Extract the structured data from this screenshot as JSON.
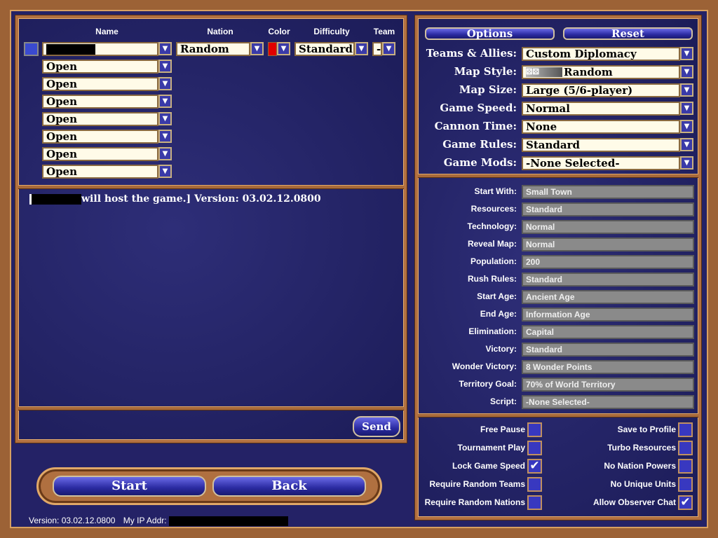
{
  "players": {
    "headers": {
      "name": "Name",
      "nation": "Nation",
      "color": "Color",
      "difficulty": "Difficulty",
      "team": "Team"
    },
    "host": {
      "name": "",
      "nation": "Random",
      "color_hex": "#e00000",
      "difficulty": "Standard",
      "team": "-",
      "slot_color_hex": "#3a4ad0"
    },
    "open_slots": [
      "Open",
      "Open",
      "Open",
      "Open",
      "Open",
      "Open",
      "Open"
    ]
  },
  "chat": {
    "message": "will host the game.] Version: 03.02.12.0800",
    "send_label": "Send"
  },
  "options": {
    "options_label": "Options",
    "reset_label": "Reset",
    "dropdowns": [
      {
        "label": "Teams & Allies:",
        "value": "Custom Diplomacy"
      },
      {
        "label": "Map Style:",
        "value": "Random",
        "icon": "dice-icon"
      },
      {
        "label": "Map Size:",
        "value": "Large (5/6-player)"
      },
      {
        "label": "Game Speed:",
        "value": "Normal"
      },
      {
        "label": "Cannon Time:",
        "value": "None"
      },
      {
        "label": "Game Rules:",
        "value": "Standard"
      },
      {
        "label": "Game Mods:",
        "value": "-None Selected-"
      }
    ],
    "settings": [
      {
        "label": "Start With:",
        "value": "Small Town"
      },
      {
        "label": "Resources:",
        "value": "Standard"
      },
      {
        "label": "Technology:",
        "value": "Normal"
      },
      {
        "label": "Reveal Map:",
        "value": "Normal"
      },
      {
        "label": "Population:",
        "value": "200"
      },
      {
        "label": "Rush Rules:",
        "value": "Standard"
      },
      {
        "label": "Start Age:",
        "value": "Ancient Age"
      },
      {
        "label": "End Age:",
        "value": "Information Age"
      },
      {
        "label": "Elimination:",
        "value": "Capital"
      },
      {
        "label": "Victory:",
        "value": "Standard"
      },
      {
        "label": "Wonder Victory:",
        "value": "8 Wonder Points"
      },
      {
        "label": "Territory Goal:",
        "value": "70% of World Territory"
      },
      {
        "label": "Script:",
        "value": "-None Selected-"
      }
    ],
    "checks_left": [
      {
        "label": "Free Pause",
        "checked": false
      },
      {
        "label": "Tournament Play",
        "checked": false
      },
      {
        "label": "Lock Game Speed",
        "checked": true
      },
      {
        "label": "Require Random Teams",
        "checked": false
      },
      {
        "label": "Require Random Nations",
        "checked": false
      }
    ],
    "checks_right": [
      {
        "label": "Save to Profile",
        "checked": false
      },
      {
        "label": "Turbo Resources",
        "checked": false
      },
      {
        "label": "No Nation Powers",
        "checked": false
      },
      {
        "label": "No Unique Units",
        "checked": false
      },
      {
        "label": "Allow Observer Chat",
        "checked": true
      }
    ]
  },
  "actions": {
    "start_label": "Start",
    "back_label": "Back"
  },
  "footer": {
    "version": "Version: 03.02.12.0800",
    "ip_label": "My IP Addr:"
  }
}
